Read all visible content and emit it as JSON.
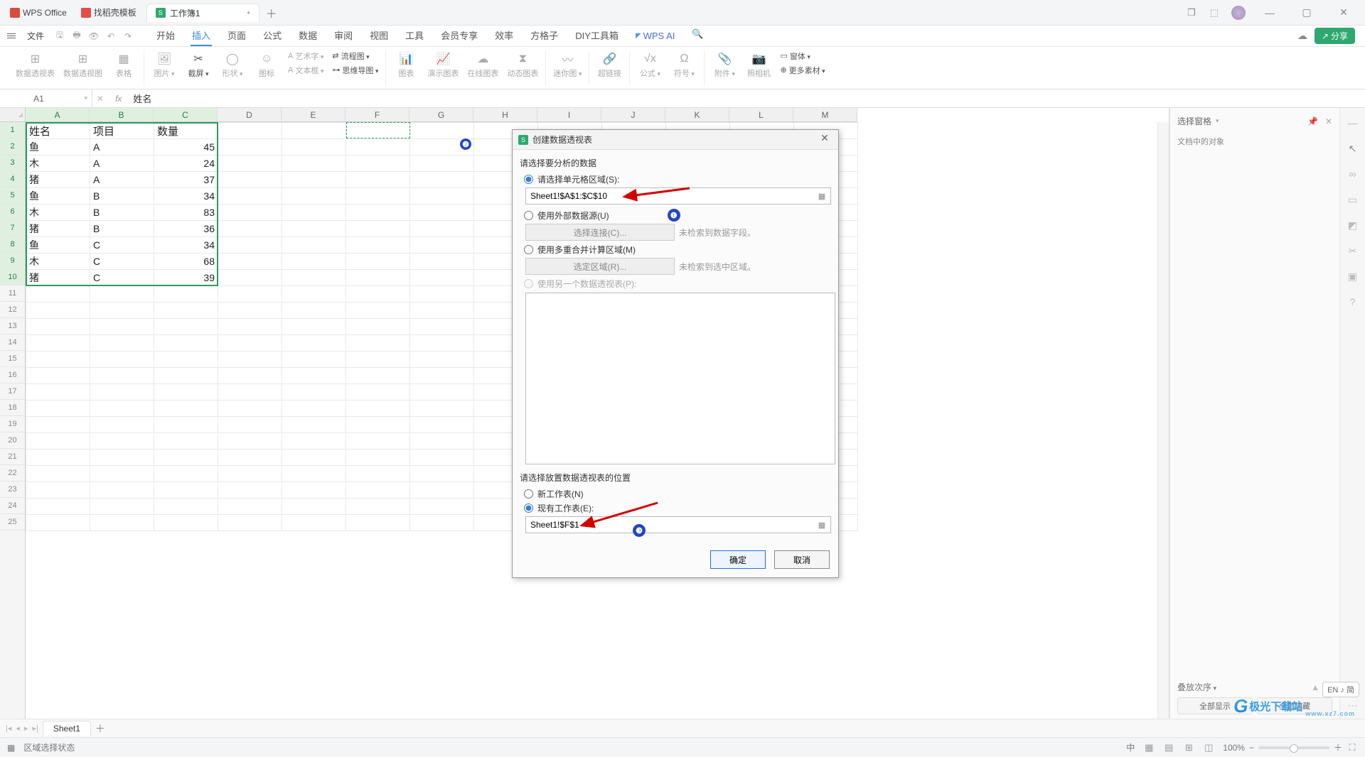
{
  "titlebar": {
    "home_tab": "WPS Office",
    "templates_tab": "找稻壳模板",
    "doc_tab": "工作簿1",
    "doc_logo": "S"
  },
  "menu": {
    "file": "文件",
    "tabs": [
      "开始",
      "插入",
      "页面",
      "公式",
      "数据",
      "审阅",
      "视图",
      "工具",
      "会员专享",
      "效率",
      "方格子",
      "DIY工具箱"
    ],
    "ai": "WPS AI",
    "share": "分享"
  },
  "ribbon": {
    "pivot_table": "数据透视表",
    "pivot_chart": "数据透视图",
    "table": "表格",
    "picture": "图片",
    "screenshot": "截屏",
    "shape": "形状",
    "icon": "图标",
    "wordart": "艺术字",
    "textbox": "文本框",
    "flowchart": "流程图",
    "mindmap": "思维导图",
    "chart": "图表",
    "demo_chart": "演示图表",
    "online_chart": "在线图表",
    "dyn_chart": "动态图表",
    "sparkline": "迷你图",
    "hyperlink": "超链接",
    "formula": "公式",
    "symbol": "符号",
    "attach": "附件",
    "camera": "照相机",
    "form": "窗体",
    "more": "更多素材"
  },
  "fbar": {
    "name": "A1",
    "fx": "fx",
    "value": "姓名"
  },
  "grid": {
    "cols": [
      "A",
      "B",
      "C",
      "D",
      "E",
      "F",
      "G",
      "H",
      "I",
      "J",
      "K",
      "L",
      "M"
    ],
    "rows_shown": 25,
    "sel_cols": [
      "A",
      "B",
      "C"
    ],
    "sel_rows": [
      1,
      2,
      3,
      4,
      5,
      6,
      7,
      8,
      9,
      10
    ],
    "data": [
      {
        "A": "姓名",
        "B": "项目",
        "C": "数量"
      },
      {
        "A": "鱼",
        "B": "A",
        "C": 45
      },
      {
        "A": "木",
        "B": "A",
        "C": 24
      },
      {
        "A": "猪",
        "B": "A",
        "C": 37
      },
      {
        "A": "鱼",
        "B": "B",
        "C": 34
      },
      {
        "A": "木",
        "B": "B",
        "C": 83
      },
      {
        "A": "猪",
        "B": "B",
        "C": 36
      },
      {
        "A": "鱼",
        "B": "C",
        "C": 34
      },
      {
        "A": "木",
        "B": "C",
        "C": 68
      },
      {
        "A": "猪",
        "B": "C",
        "C": 39
      }
    ]
  },
  "dialog": {
    "title": "创建数据透视表",
    "sec1": "请选择要分析的数据",
    "opt1": "请选择单元格区域(S):",
    "range_input": "Sheet1!$A$1:$C$10",
    "opt2": "使用外部数据源(U)",
    "btn_conn": "选择连接(C)...",
    "hint_conn": "未检索到数据字段。",
    "opt3": "使用多重合并计算区域(M)",
    "btn_area": "选定区域(R)...",
    "hint_area": "未检索到选中区域。",
    "opt4": "使用另一个数据透视表(P):",
    "sec2": "请选择放置数据透视表的位置",
    "loc1": "新工作表(N)",
    "loc2": "现有工作表(E):",
    "loc_input": "Sheet1!$F$1",
    "ok": "确定",
    "cancel": "取消"
  },
  "taskpane": {
    "title": "选择窗格",
    "sub": "文档中的对象",
    "stack": "叠放次序",
    "show_all": "全部显示",
    "hide_all": "全部隐藏"
  },
  "sheetbar": {
    "sheet": "Sheet1"
  },
  "statusbar": {
    "mode": "区域选择状态",
    "lang": "中",
    "zoom": "100%"
  },
  "ime": "EN ♪ 简",
  "watermark": {
    "text": "极光下载站",
    "sub": "www.xz7.com"
  }
}
